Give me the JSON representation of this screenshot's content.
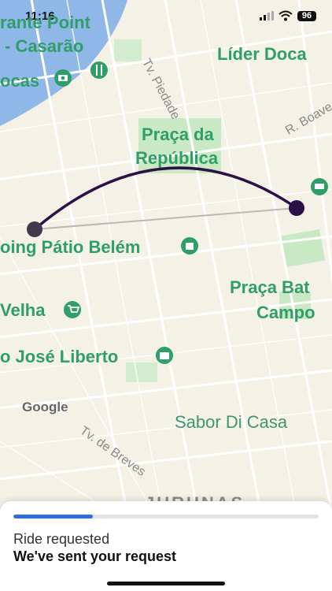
{
  "status_bar": {
    "time": "11:16",
    "battery": "96"
  },
  "map": {
    "labels": {
      "poi_top_left_1": "rante Point",
      "poi_top_left_2": "- Casarão",
      "poi_docas": "ocas",
      "poi_lider": "Líder Doca",
      "poi_praca_rep_1": "Praça da",
      "poi_praca_rep_2": "República",
      "poi_patio": "oing Pátio Belém",
      "poi_praca_bat_1": "Praça Bat",
      "poi_praca_bat_2": "Campo",
      "poi_velha": "Velha",
      "poi_jose": "o José Liberto",
      "poi_sabor": "Sabor Di Casa",
      "district": "JURUNAS"
    },
    "streets": {
      "piedade": "Tv. Piedade",
      "boave": "R. Boave",
      "breves": "Tv. de Breves"
    },
    "attribution": "Google"
  },
  "sheet": {
    "progress": 0.26,
    "status_label": "Ride requested",
    "status_detail": "We've sent your request"
  }
}
